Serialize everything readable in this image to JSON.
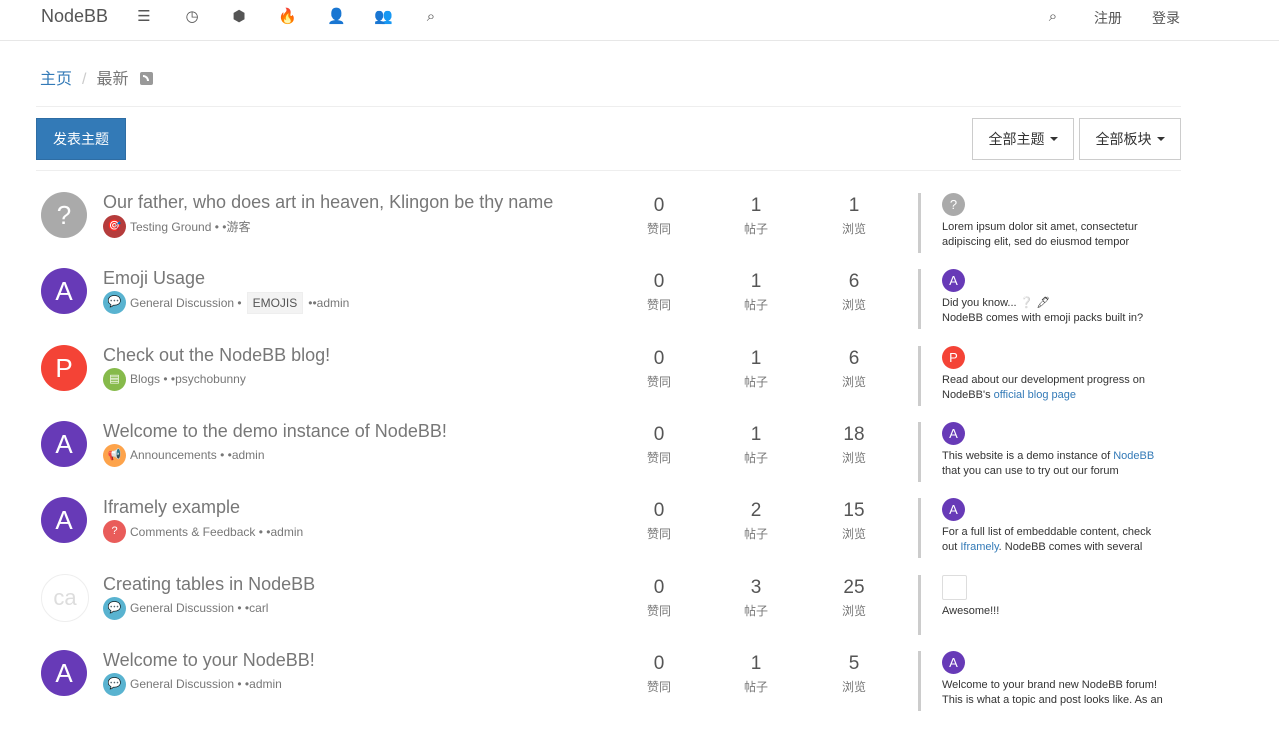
{
  "nav": {
    "brand": "NodeBB",
    "register": "注册",
    "login": "登录"
  },
  "breadcrumb": {
    "home": "主页",
    "current": "最新"
  },
  "toolbar": {
    "new_topic": "发表主题",
    "all_topics": "全部主题",
    "all_categories": "全部板块"
  },
  "labels": {
    "votes": "赞同",
    "posts": "帖子",
    "views": "浏览"
  },
  "topics": [
    {
      "title": "Our father, who does art in heaven, Klingon be thy name",
      "avatar_letter": "?",
      "avatar_color": "#aaaaaa",
      "category": "Testing Ground",
      "category_color": "#b53c3c",
      "category_icon": "🎯",
      "tag": "",
      "author": "游客",
      "votes": "0",
      "posts": "1",
      "views": "1",
      "teaser_letter": "?",
      "teaser_color": "#aaaaaa",
      "teaser_line1": "Lorem ipsum dolor sit amet, consectetur",
      "teaser_line2": "adipiscing elit, sed do eiusmod tempor"
    },
    {
      "title": "Emoji Usage",
      "avatar_letter": "A",
      "avatar_color": "#673ab7",
      "category": "General Discussion",
      "category_color": "#59b3d0",
      "category_icon": "💬",
      "tag": "EMOJIS",
      "author": "admin",
      "votes": "0",
      "posts": "1",
      "views": "6",
      "teaser_letter": "A",
      "teaser_color": "#673ab7",
      "teaser_line1": "Did you know... ❔ 🖋",
      "teaser_line2": "NodeBB comes with emoji packs built in?"
    },
    {
      "title": "Check out the NodeBB blog!",
      "avatar_letter": "P",
      "avatar_color": "#f44336",
      "category": "Blogs",
      "category_color": "#86ba4b",
      "category_icon": "▤",
      "tag": "",
      "author": "psychobunny",
      "votes": "0",
      "posts": "1",
      "views": "6",
      "teaser_letter": "P",
      "teaser_color": "#f44336",
      "teaser_line1": "Read about our development progress on",
      "teaser_line2_pre": "NodeBB's ",
      "teaser_line2_link": "official blog page"
    },
    {
      "title": "Welcome to the demo instance of NodeBB!",
      "avatar_letter": "A",
      "avatar_color": "#673ab7",
      "category": "Announcements",
      "category_color": "#fda34b",
      "category_icon": "📢",
      "tag": "",
      "author": "admin",
      "votes": "0",
      "posts": "1",
      "views": "18",
      "teaser_letter": "A",
      "teaser_color": "#673ab7",
      "teaser_line1_pre": "This website is a demo instance of ",
      "teaser_line1_link": "NodeBB",
      "teaser_line2": "that you can use to try out our forum"
    },
    {
      "title": "Iframely example",
      "avatar_letter": "A",
      "avatar_color": "#673ab7",
      "category": "Comments & Feedback",
      "category_color": "#e95c5a",
      "category_icon": "?",
      "tag": "",
      "author": "admin",
      "votes": "0",
      "posts": "2",
      "views": "15",
      "teaser_letter": "A",
      "teaser_color": "#673ab7",
      "teaser_line1": "For a full list of embeddable content, check",
      "teaser_line2_pre": "out ",
      "teaser_line2_link": "Iframely",
      "teaser_line2_post": ". NodeBB comes with several"
    },
    {
      "title": "Creating tables in NodeBB",
      "avatar_letter": "ca",
      "avatar_color": "#ffffff",
      "category": "General Discussion",
      "category_color": "#59b3d0",
      "category_icon": "💬",
      "tag": "",
      "author": "carl",
      "votes": "0",
      "posts": "3",
      "views": "25",
      "teaser_letter": "",
      "teaser_color": "#ffffff",
      "teaser_line1": "Awesome!!!",
      "teaser_line2": ""
    },
    {
      "title": "Welcome to your NodeBB!",
      "avatar_letter": "A",
      "avatar_color": "#673ab7",
      "category": "General Discussion",
      "category_color": "#59b3d0",
      "category_icon": "💬",
      "tag": "",
      "author": "admin",
      "votes": "0",
      "posts": "1",
      "views": "5",
      "teaser_letter": "A",
      "teaser_color": "#673ab7",
      "teaser_line1": "Welcome to your brand new NodeBB forum!",
      "teaser_line2": "This is what a topic and post looks like. As an"
    }
  ]
}
